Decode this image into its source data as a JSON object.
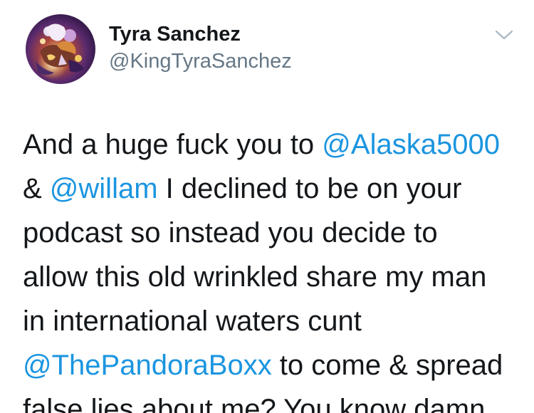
{
  "user": {
    "display_name": "Tyra Sanchez",
    "handle": "@KingTyraSanchez",
    "avatar_icon": "profile-illustration"
  },
  "menu": {
    "icon": "chevron-down-icon"
  },
  "colors": {
    "text": "#14171a",
    "secondary": "#657786",
    "link": "#1b95e0",
    "background": "#ffffff"
  },
  "tweet": {
    "lines": [
      {
        "parts": [
          {
            "type": "text",
            "text": "And a huge fuck you to "
          },
          {
            "type": "mention",
            "text": "@Alaska5000"
          }
        ]
      },
      {
        "parts": [
          {
            "type": "text",
            "text": "& "
          },
          {
            "type": "mention",
            "text": "@willam"
          },
          {
            "type": "text",
            "text": " I declined to be on your"
          }
        ]
      },
      {
        "parts": [
          {
            "type": "text",
            "text": "podcast so instead you decide to"
          }
        ]
      },
      {
        "parts": [
          {
            "type": "text",
            "text": "allow this old wrinkled share my man"
          }
        ]
      },
      {
        "parts": [
          {
            "type": "text",
            "text": "in international waters cunt"
          }
        ]
      },
      {
        "parts": [
          {
            "type": "mention",
            "text": "@ThePandoraBoxx"
          },
          {
            "type": "text",
            "text": " to come & spread"
          }
        ]
      },
      {
        "parts": [
          {
            "type": "text",
            "text": "false lies about me? You know damn"
          }
        ]
      }
    ]
  }
}
